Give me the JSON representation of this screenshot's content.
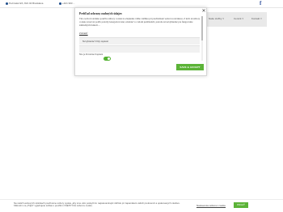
{
  "topbar": {
    "address": "Pezinská 9/A, 821 04 Bratislava",
    "phone": "+421 903…",
    "facebook_icon": "facebook-icon"
  },
  "nav": {
    "items": [
      {
        "label": "Naše služby",
        "icon": "chevron-down-icon"
      },
      {
        "label": "Cenník",
        "icon": "chevron-down-icon"
      },
      {
        "label": "Kontakt",
        "icon": "chevron-down-icon"
      }
    ]
  },
  "modal": {
    "title": "Prehľad ochrany osobných údajov",
    "body": "Táto webová stránka používa súbory cookie na zlepšenie vášho zážitku pri prechádzaní webovou stránkou. Z nich sú súbory cookie, ktoré sú podľa potreby kategorizované, uložené vo vašom prehliadači, pretože sú nevyhnutné pre fungovanie základných funkcií…",
    "read_more": "Zobraziť",
    "rows": [
      {
        "label": "Nevyhnutné Vždy zapnuté"
      },
      {
        "label": ""
      }
    ],
    "toggle_label": "Nie je Potrebné Zapnuté",
    "toggle_on": true,
    "close_icon": "close-icon",
    "accept_label": "SAVE & ACCEPT",
    "accent": "#5cb338"
  },
  "cookie_bar": {
    "text": "Na našich webových stránkach používame súbory cookie, aby sme vám poskytli čo najrelevantnejší zážitok pri zapamätaní vašich preferencií a opakovaných návštev. Kliknutím na „Prijať\" vyjadrujete súhlas s použitím VŠETKÝCH súborov cookie.",
    "settings_link": "Nastavenia súborov cookie",
    "accept_label": "PRIJAŤ"
  }
}
